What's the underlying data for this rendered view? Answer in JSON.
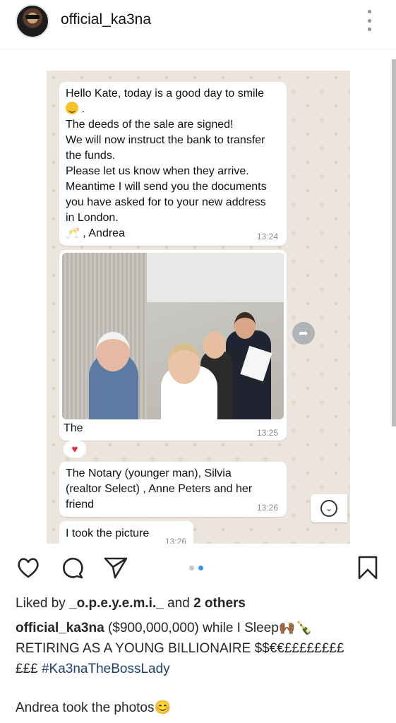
{
  "header": {
    "username": "official_ka3na"
  },
  "chat": {
    "msg1": {
      "lines": [
        "Hello Kate, today is a good day to smile",
        "",
        "The deeds of the sale are signed!",
        "We will now instruct the bank to transfer",
        "the funds.",
        "Please let us know when they arrive.",
        "Meantime I will send you the documents",
        "you have asked for to your new address",
        "in London.",
        "🥂 , Andrea"
      ],
      "time": "13:24"
    },
    "msg2": {
      "caption": "The",
      "time": "13:25",
      "reaction": "♥"
    },
    "msg3": {
      "lines": [
        "The Notary (younger man), Silvia",
        "(realtor Select) , Anne Peters and her",
        "friend"
      ],
      "time": "13:26"
    },
    "msg4": {
      "text": "I took the picture",
      "time": "13:26"
    }
  },
  "carousel": {
    "count": 2,
    "active_index": 1,
    "active_color": "#3897f0",
    "inactive_color": "#c7c7c7"
  },
  "post": {
    "liked_by_prefix": "Liked by ",
    "liked_by_user": "_o.p.e.y.e.m.i._",
    "liked_by_mid": " and ",
    "liked_by_others": "2 others",
    "caption_user": "official_ka3na",
    "caption_line1": " ($900,000,000) while I Sleep🙌🏾🍾",
    "caption_line2": "RETIRING AS A YOUNG BILLIONAIRE $$€€££££££££",
    "caption_line3": "£££ ",
    "hashtag": "#Ka3naTheBossLady",
    "comment": "Andrea took the photos😊"
  },
  "icons": {
    "like": "heart-icon",
    "comment": "comment-icon",
    "share": "send-icon",
    "save": "bookmark-icon",
    "more": "more-vertical-icon",
    "forward": "forward-arrow-icon",
    "scroll": "chevron-down-circle-icon"
  }
}
